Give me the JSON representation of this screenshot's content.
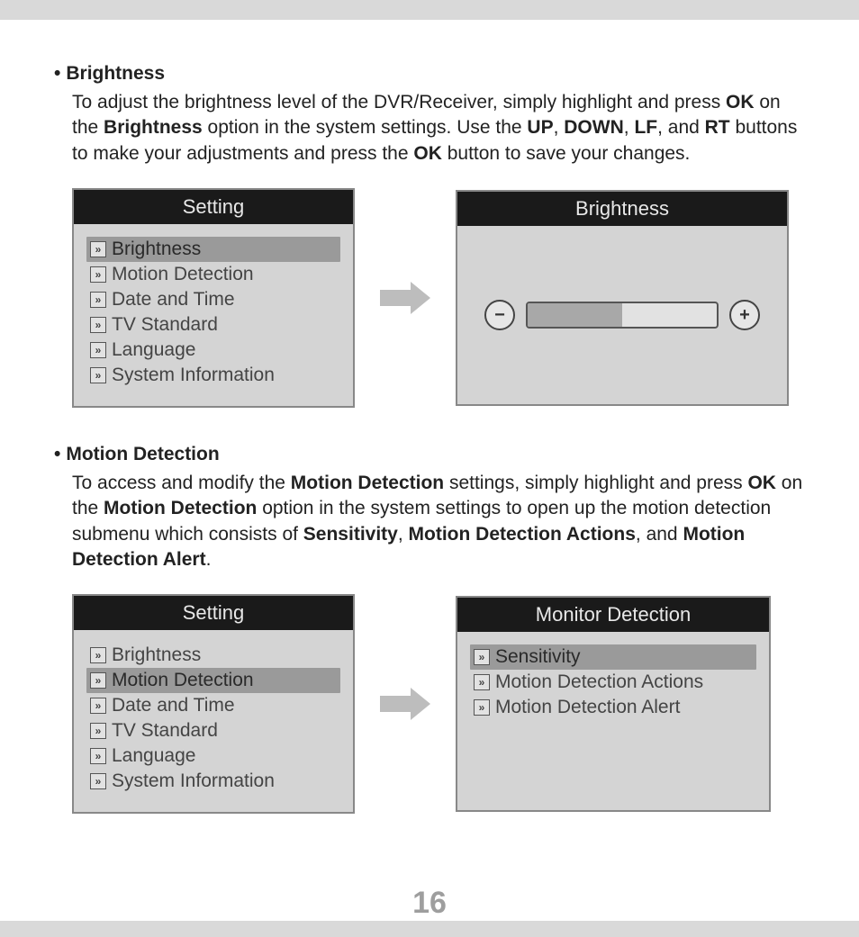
{
  "sections": {
    "brightness": {
      "title": "Brightness",
      "body_parts": {
        "p1": "To adjust the brightness level of the DVR/Receiver, simply highlight and press ",
        "p2": " on the ",
        "p3": " option in the system settings. Use the ",
        "p4": ", ",
        "p5": ", ",
        "p6": ", and ",
        "p7": " buttons to make your adjustments and press the ",
        "p8": " button to save your changes."
      },
      "bold": {
        "ok1": "OK",
        "brightness": "Brightness",
        "up": "UP",
        "down": "DOWN",
        "lf": "LF",
        "rt": "RT",
        "ok2": "OK"
      }
    },
    "motion": {
      "title": "Motion Detection",
      "body_parts": {
        "p1": "To access and modify the ",
        "p2": " settings, simply highlight and press ",
        "p3": " on the ",
        "p4": " option in the system settings to open up the motion detection submenu which consists of ",
        "p5": ", ",
        "p6": ", and ",
        "p7": "."
      },
      "bold": {
        "md1": "Motion Detection",
        "ok": "OK",
        "md2": "Motion Detection",
        "sens": "Sensitivity",
        "mda": "Motion Detection Actions",
        "mdalert": "Motion Detection Alert"
      }
    }
  },
  "panels": {
    "setting1": {
      "title": "Setting",
      "items": {
        "i0": "Brightness",
        "i1": "Motion Detection",
        "i2": "Date and Time",
        "i3": "TV Standard",
        "i4": "Language",
        "i5": "System Information"
      }
    },
    "brightness": {
      "title": "Brightness",
      "minus": "−",
      "plus": "+",
      "slider_percent": 50
    },
    "setting2": {
      "title": "Setting",
      "items": {
        "i0": "Brightness",
        "i1": "Motion Detection",
        "i2": "Date and Time",
        "i3": "TV Standard",
        "i4": "Language",
        "i5": "System Information"
      }
    },
    "monitor_detection": {
      "title": "Monitor Detection",
      "items": {
        "i0": "Sensitivity",
        "i1": "Motion Detection Actions",
        "i2": "Motion Detection Alert"
      }
    }
  },
  "icons": {
    "menu_glyph": "»"
  },
  "page_number": "16"
}
